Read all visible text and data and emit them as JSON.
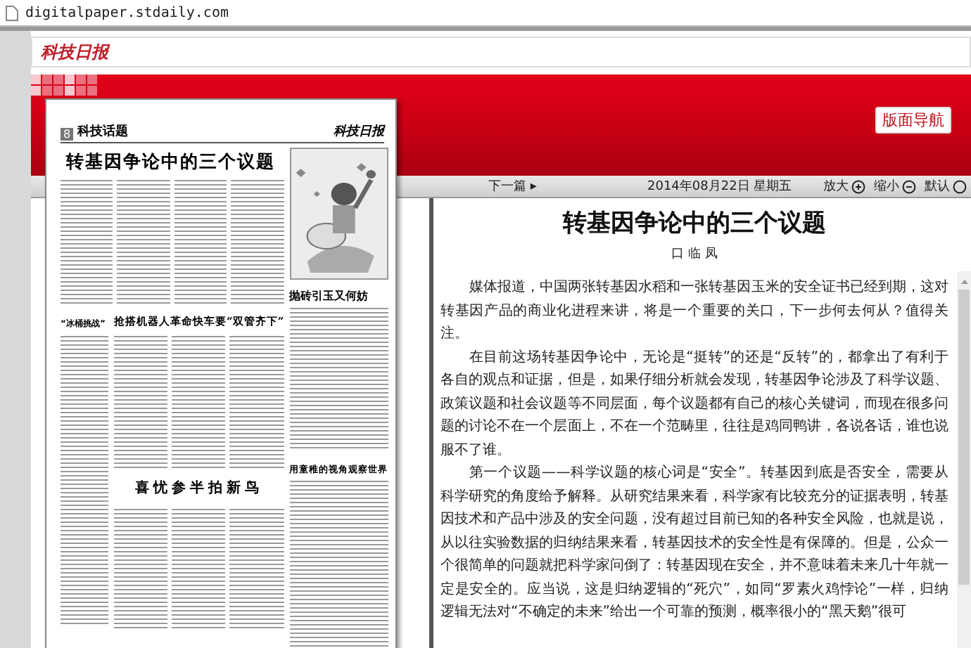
{
  "address_bar": {
    "url": "digitalpaper.stdaily.com"
  },
  "header": {
    "logo": "科技日报"
  },
  "banner": {
    "nav_button": "版面导航"
  },
  "newspaper_page": {
    "page_number": "8",
    "section": "科技话题",
    "logo": "科技日报",
    "main_headline": "转基因争论中的三个议题",
    "left_headline": "“冰桶挑战”",
    "robot_headline": "抢搭机器人革命快车要“双管齐下”",
    "bottom_headline": "喜忧参半拍新鸟",
    "sidebar_headline": "抛砖引玉又何妨",
    "right_headline": "用童稚的视角观察世界"
  },
  "toolbar": {
    "next": "下一篇",
    "next_arrow": "▸",
    "date": "2014年08月22日 星期五",
    "controls": [
      {
        "label": "放大",
        "kind": "plus"
      },
      {
        "label": "缩小",
        "kind": "minus"
      },
      {
        "label": "默认",
        "kind": "circle"
      }
    ]
  },
  "article": {
    "title": "转基因争论中的三个议题",
    "author": "口 临 凤",
    "paragraphs": [
      "媒体报道，中国两张转基因水稻和一张转基因玉米的安全证书已经到期，这对转基因产品的商业化进程来讲，将是一个重要的关口，下一步何去何从？值得关注。",
      "在目前这场转基因争论中，无论是“挺转”的还是“反转”的，都拿出了有利于各自的观点和证据，但是，如果仔细分析就会发现，转基因争论涉及了科学议题、政策议题和社会议题等不同层面，每个议题都有自己的核心关键词，而现在很多问题的讨论不在一个层面上，不在一个范畴里，往往是鸡同鸭讲，各说各话，谁也说服不了谁。",
      "第一个议题——科学议题的核心词是“安全”。转基因到底是否安全，需要从科学研究的角度给予解释。从研究结果来看，科学家有比较充分的证据表明，转基因技术和产品中涉及的安全问题，没有超过目前已知的各种安全风险，也就是说，从以往实验数据的归纳结果来看，转基因技术的安全性是有保障的。但是，公众一个很简单的问题就把科学家问倒了：转基因现在安全，并不意味着未来几十年就一定是安全的。应当说，这是归纳逻辑的“死穴”，如同“罗素火鸡悖论”一样，归纳逻辑无法对“不确定的未来”给出一个可靠的预测，概率很小的“黑天鹅”很可"
    ]
  }
}
